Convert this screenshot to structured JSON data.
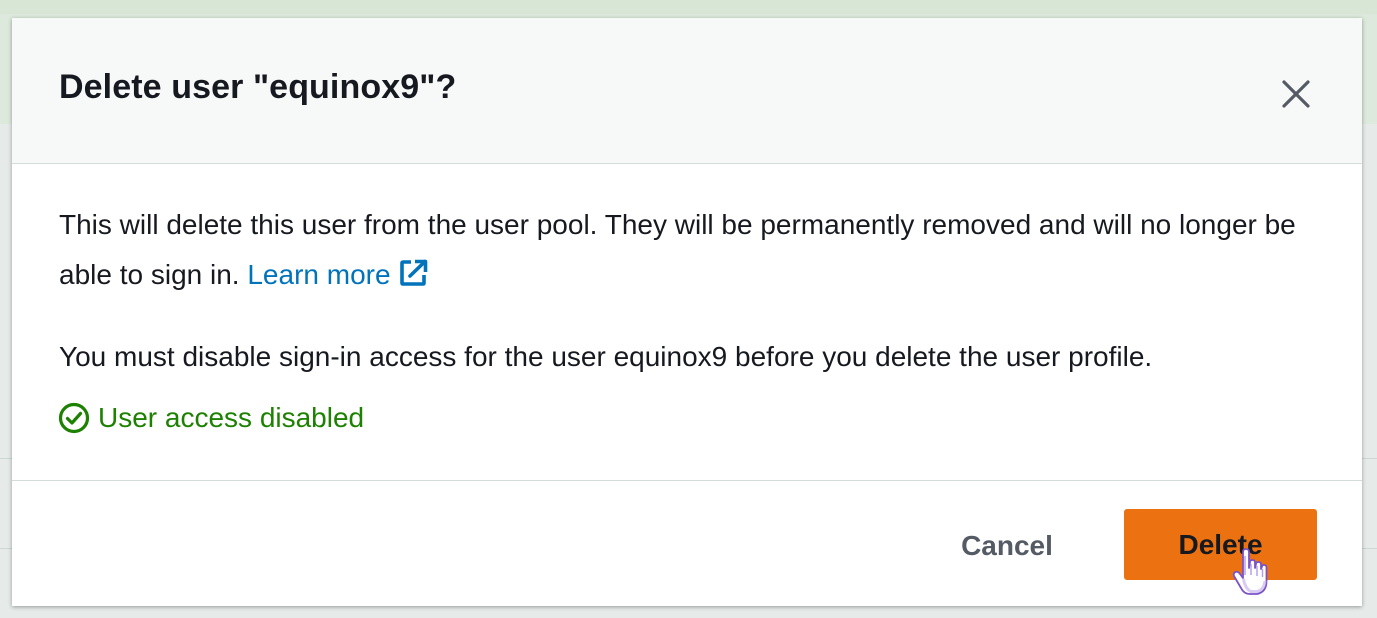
{
  "modal": {
    "title": "Delete user \"equinox9\"?",
    "close_icon": "close-icon",
    "body": {
      "paragraph1_text": "This will delete this user from the user pool. They will be permanently removed and will no longer be able to sign in.",
      "learn_more_label": "Learn more",
      "learn_more_icon": "external-link-icon",
      "paragraph2_text": "You must disable sign-in access for the user equinox9 before you delete the user profile.",
      "status": {
        "icon": "check-circle-icon",
        "label": "User access disabled",
        "color": "#1d8102"
      }
    },
    "footer": {
      "cancel_label": "Cancel",
      "delete_label": "Delete"
    }
  },
  "colors": {
    "primary_button": "#ec7211",
    "link": "#0073bb",
    "success": "#1d8102",
    "title_text": "#16191f",
    "secondary_text": "#545b64"
  }
}
